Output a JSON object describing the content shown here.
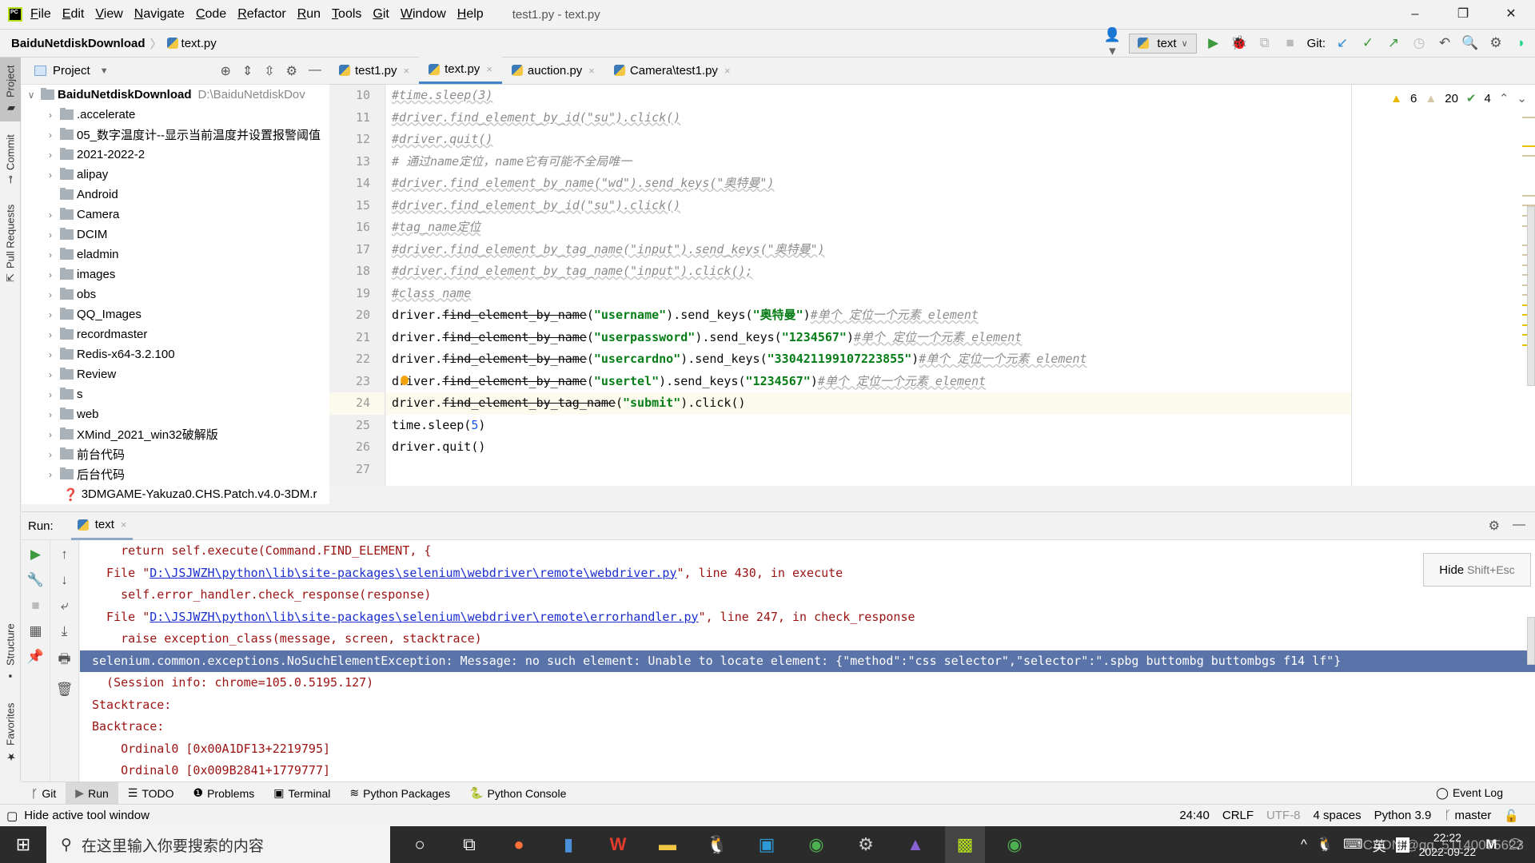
{
  "menubar": {
    "items": [
      "File",
      "Edit",
      "View",
      "Navigate",
      "Code",
      "Refactor",
      "Run",
      "Tools",
      "Git",
      "Window",
      "Help"
    ],
    "window_title": "test1.py - text.py"
  },
  "window_controls": {
    "minimize": "–",
    "restore": "❐",
    "close": "✕"
  },
  "navbar": {
    "project": "BaiduNetdiskDownload",
    "file": "text.py"
  },
  "toolbar": {
    "run_config": "text",
    "git_label": "Git:",
    "icons": [
      "user-icon",
      "run-icon",
      "debug-icon",
      "coverage-icon",
      "stop-icon",
      "git-update-icon",
      "git-commit-icon",
      "git-push-icon",
      "history-icon",
      "rollback-icon",
      "search-icon",
      "settings-icon",
      "jetbrains-icon"
    ]
  },
  "side_tabs": {
    "project": "Project",
    "commit": "Commit",
    "pull_requests": "Pull Requests",
    "structure": "Structure",
    "favorites": "Favorites"
  },
  "project_panel": {
    "title": "Project",
    "root": {
      "name": "BaiduNetdiskDownload",
      "path": "D:\\BaiduNetdiskDov"
    },
    "items": [
      {
        "name": ".accelerate",
        "expandable": true
      },
      {
        "name": "05_数字温度计--显示当前温度并设置报警阈值",
        "expandable": true
      },
      {
        "name": "2021-2022-2",
        "expandable": true
      },
      {
        "name": "alipay",
        "expandable": true
      },
      {
        "name": "Android",
        "expandable": false
      },
      {
        "name": "Camera",
        "expandable": true
      },
      {
        "name": "DCIM",
        "expandable": true
      },
      {
        "name": "eladmin",
        "expandable": true
      },
      {
        "name": "images",
        "expandable": true
      },
      {
        "name": "obs",
        "expandable": true
      },
      {
        "name": "QQ_Images",
        "expandable": true
      },
      {
        "name": "recordmaster",
        "expandable": true
      },
      {
        "name": "Redis-x64-3.2.100",
        "expandable": true
      },
      {
        "name": "Review",
        "expandable": true
      },
      {
        "name": "s",
        "expandable": true
      },
      {
        "name": "web",
        "expandable": true
      },
      {
        "name": "XMind_2021_win32破解版",
        "expandable": true
      },
      {
        "name": "前台代码",
        "expandable": true
      },
      {
        "name": "后台代码",
        "expandable": true
      }
    ],
    "file_item": "3DMGAME-Yakuza0.CHS.Patch.v4.0-3DM.r"
  },
  "editor": {
    "tabs": [
      {
        "label": "test1.py",
        "active": false
      },
      {
        "label": "text.py",
        "active": true
      },
      {
        "label": "auction.py",
        "active": false
      },
      {
        "label": "Camera\\test1.py",
        "active": false
      }
    ],
    "inspections": {
      "warnings": "6",
      "weak_warnings": "20",
      "typos": "4"
    },
    "line_numbers": [
      "10",
      "11",
      "12",
      "13",
      "14",
      "15",
      "16",
      "17",
      "18",
      "19",
      "20",
      "21",
      "22",
      "23",
      "24",
      "25",
      "26",
      "27"
    ],
    "lines": {
      "l10": "#time.sleep(3)",
      "l11": "#driver.find_element_by_id(\"su\").click()",
      "l12": "#driver.quit()",
      "l13": "# 通过name定位，name它有可能不全局唯一",
      "l14": "#driver.find_element_by_name(\"wd\").send_keys(\"奥特曼\")",
      "l15": "#driver.find_element_by_id(\"su\").click()",
      "l16": "#tag_name定位",
      "l17": "#driver.find_element_by_tag_name(\"input\").send_keys(\"奥特曼\")",
      "l18": "#driver.find_element_by_tag_name(\"input\").click();",
      "l19": "#class name",
      "l20": {
        "a": "driver.",
        "b": "find_element_by_name",
        "c": "(",
        "d": "\"username\"",
        "e": ").send_keys(",
        "f": "\"奥特曼\"",
        "g": ")",
        "h": "#单个 定位一个元素 element"
      },
      "l21": {
        "a": "driver.",
        "b": "find_element_by_name",
        "c": "(",
        "d": "\"userpassword\"",
        "e": ").send_keys(",
        "f": "\"1234567\"",
        "g": ")",
        "h": "#单个 定位一个元素 element"
      },
      "l22": {
        "a": "driver.",
        "b": "find_element_by_name",
        "c": "(",
        "d": "\"usercardno\"",
        "e": ").send_keys(",
        "f": "\"330421199107223855\"",
        "g": ")",
        "h": "#单个 定位一个元素 element"
      },
      "l23": {
        "a": "driver.",
        "b": "find_element_by_name",
        "c": "(",
        "d": "\"usertel\"",
        "e": ").send_keys(",
        "f": "\"1234567\"",
        "g": ")",
        "h": "#单个 定位一个元素 element"
      },
      "l24": {
        "a": "driver.",
        "b": "find_element_by_tag_name",
        "c": "(",
        "d": "\"submit\"",
        "e": ").click()"
      },
      "l25": {
        "a": "time.sleep(",
        "n": "5",
        "b": ")"
      },
      "l26": "driver.quit()",
      "l27": ""
    }
  },
  "run_panel": {
    "label": "Run:",
    "tab": "text",
    "hide_button": {
      "label": "Hide",
      "shortcut": "Shift+Esc"
    },
    "output": [
      {
        "text": "    return self.execute(Command.FIND_ELEMENT, {"
      },
      {
        "pre": "  File \"",
        "link": "D:\\JSJWZH\\python\\lib\\site-packages\\selenium\\webdriver\\remote\\webdriver.py",
        "post": "\", line 430, in execute"
      },
      {
        "text": "    self.error_handler.check_response(response)"
      },
      {
        "pre": "  File \"",
        "link": "D:\\JSJWZH\\python\\lib\\site-packages\\selenium\\webdriver\\remote\\errorhandler.py",
        "post": "\", line 247, in check_response"
      },
      {
        "text": "    raise exception_class(message, screen, stacktrace)"
      },
      {
        "text": "selenium.common.exceptions.NoSuchElementException: Message: no such element: Unable to locate element: {\"method\":\"css selector\",\"selector\":\".spbg buttombg buttombgs f14 lf\"}",
        "selected": true
      },
      {
        "text": "  (Session info: chrome=105.0.5195.127)"
      },
      {
        "text": "Stacktrace:"
      },
      {
        "text": "Backtrace:"
      },
      {
        "text": "    Ordinal0 [0x00A1DF13+2219795]"
      },
      {
        "text": "    Ordinal0 [0x009B2841+1779777]"
      }
    ]
  },
  "bottom_tabs": [
    "Git",
    "Run",
    "TODO",
    "Problems",
    "Terminal",
    "Python Packages",
    "Python Console"
  ],
  "event_log": "Event Log",
  "statusbar": {
    "hint": "Hide active tool window",
    "position": "24:40",
    "line_sep": "CRLF",
    "encoding": "UTF-8",
    "indent": "4 spaces",
    "interpreter": "Python 3.9",
    "branch": "master"
  },
  "taskbar": {
    "search_placeholder": "在这里输入你要搜索的内容",
    "apps": [
      "cortana-icon",
      "task-view-icon",
      "firefox-icon",
      "winrar-icon",
      "wps-icon",
      "file-explorer-icon",
      "qq-icon",
      "remote-icon",
      "chrome-icon",
      "javaee-ide-icon",
      "app-icon",
      "pycharm-icon",
      "chrome-icon"
    ],
    "ime_lang": "英",
    "ime_mode": "拼",
    "time": "22:22",
    "date": "2022-09-22",
    "watermark": "CSDN @qq_51140075623"
  }
}
